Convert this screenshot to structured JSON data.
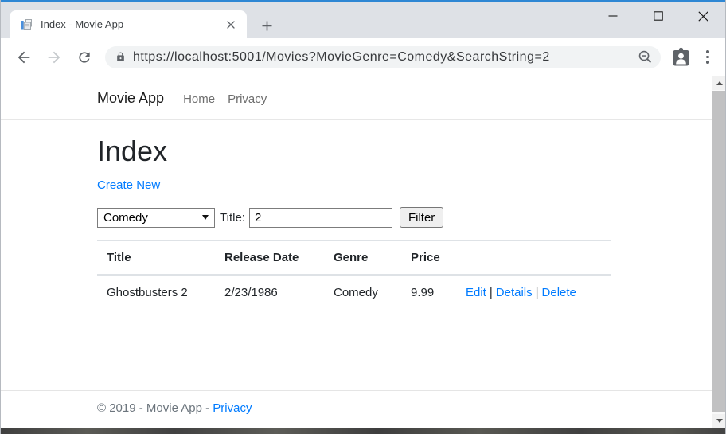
{
  "window": {
    "controls": {
      "minimize": "minimize",
      "maximize": "maximize",
      "close": "close"
    }
  },
  "browser": {
    "tab_title": "Index - Movie App",
    "url": "https://localhost:5001/Movies?MovieGenre=Comedy&SearchString=2"
  },
  "page": {
    "navbar": {
      "brand": "Movie App",
      "home": "Home",
      "privacy": "Privacy"
    },
    "heading": "Index",
    "create_new_label": "Create New",
    "filter": {
      "genre_selected": "Comedy",
      "title_label": "Title:",
      "search_value": "2",
      "filter_button_label": "Filter"
    },
    "table": {
      "headers": [
        "Title",
        "Release Date",
        "Genre",
        "Price"
      ],
      "rows": [
        {
          "title": "Ghostbusters 2",
          "release_date": "2/23/1986",
          "genre": "Comedy",
          "price": "9.99",
          "actions": {
            "edit": "Edit",
            "details": "Details",
            "delete": "Delete"
          },
          "action_separator": "|"
        }
      ]
    },
    "footer": {
      "copyright": "© 2019 - Movie App -",
      "privacy_link": "Privacy"
    }
  },
  "icons": {
    "favicon": "document-page",
    "tab_close": "x",
    "new_tab": "plus",
    "back": "arrow-left",
    "forward": "arrow-right",
    "reload": "circular-arrow",
    "lock": "padlock",
    "zoom_out": "magnifier-minus",
    "profile": "person-badge",
    "menu": "vertical-dots",
    "select_arrow": "triangle-down",
    "scroll_up": "triangle-up",
    "scroll_down": "triangle-down"
  },
  "colors": {
    "link": "#007bff",
    "chrome_top_strip": "#2e87d4",
    "tabbar_bg": "#dee1e6",
    "omnibox_bg": "#f1f3f4",
    "muted_text": "#6c757d",
    "table_border": "#dee2e6",
    "icon_gray": "#5f6368"
  }
}
